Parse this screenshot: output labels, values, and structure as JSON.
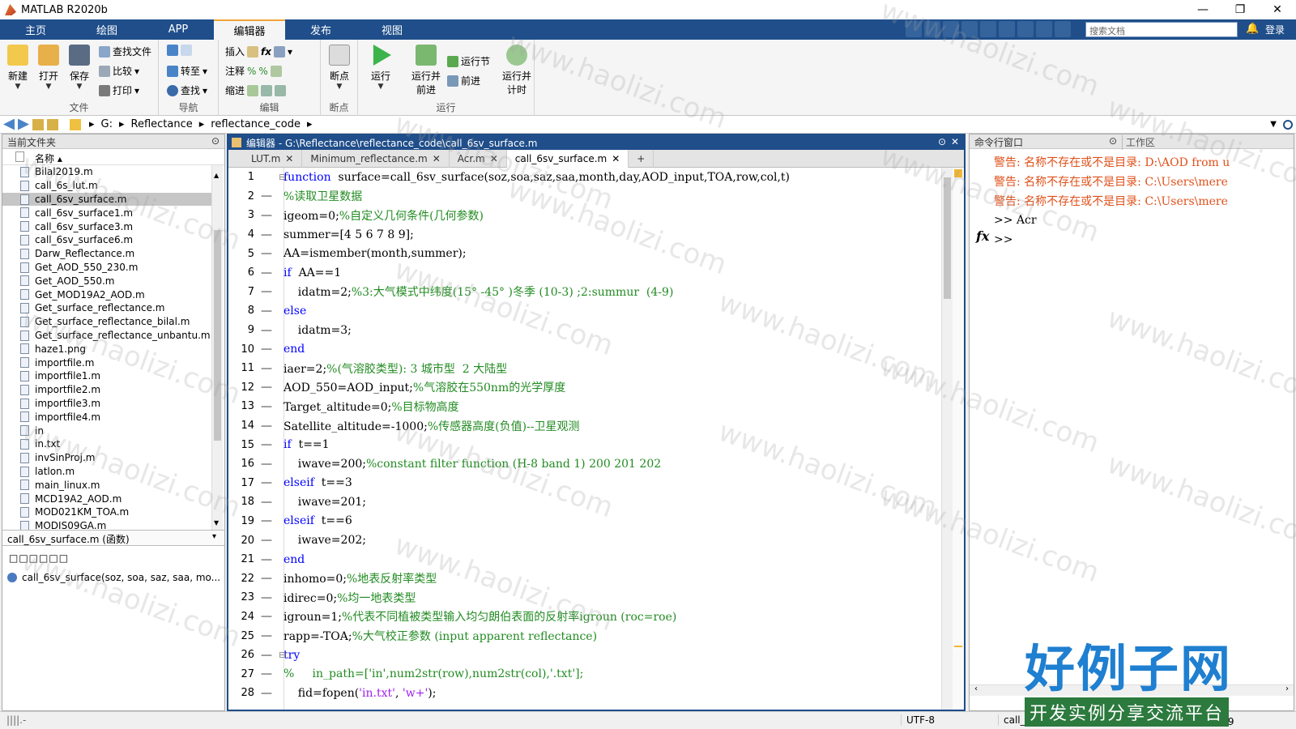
{
  "window": {
    "title": "MATLAB R2020b",
    "min": "—",
    "max": "❐",
    "close": "✕"
  },
  "tabs": [
    "主页",
    "绘图",
    "APP",
    "编辑器",
    "发布",
    "视图"
  ],
  "search": {
    "placeholder": "搜索文档"
  },
  "login": "登录",
  "ribbon": {
    "file": {
      "label": "文件",
      "new": "新建",
      "open": "打开",
      "save": "保存",
      "find_files": "查找文件",
      "compare": "比较",
      "print": "打印"
    },
    "nav": {
      "label": "导航",
      "goto": "转至",
      "find": "查找"
    },
    "edit": {
      "label": "编辑",
      "insert": "插入",
      "comment": "注释",
      "indent": "缩进"
    },
    "breakpoints": {
      "label": "断点",
      "breakpoint": "断点"
    },
    "run": {
      "label": "运行",
      "run": "运行",
      "run_advance": "运行并\n前进",
      "run_section": "运行节",
      "advance": "前进",
      "run_time": "运行并\n计时"
    }
  },
  "address": {
    "drive": "G:",
    "parts": [
      "Reflectance",
      "reflectance_code"
    ]
  },
  "current_folder": {
    "title": "当前文件夹",
    "col_name": "名称 ▴",
    "files": [
      "Bilal2019.m",
      "call_6s_lut.m",
      "call_6sv_surface.m",
      "call_6sv_surface1.m",
      "call_6sv_surface3.m",
      "call_6sv_surface6.m",
      "Darw_Reflectance.m",
      "Get_AOD_550_230.m",
      "Get_AOD_550.m",
      "Get_MOD19A2_AOD.m",
      "Get_surface_reflectance.m",
      "Get_surface_reflectance_bilal.m",
      "Get_surface_reflectance_unbantu.m",
      "haze1.png",
      "importfile.m",
      "importfile1.m",
      "importfile2.m",
      "importfile3.m",
      "importfile4.m",
      "in",
      "in.txt",
      "invSinProj.m",
      "latlon.m",
      "main_linux.m",
      "MCD19A2_AOD.m",
      "MOD021KM_TOA.m",
      "MODIS09GA.m"
    ],
    "selected": "call_6sv_surface.m",
    "detail_title": "call_6sv_surface.m  (函数)",
    "detail_box": "□□□□□□",
    "detail_sig": "call_6sv_surface(soz, soa, saz, saa, mo..."
  },
  "editor": {
    "title": "编辑器 - G:\\Reflectance\\reflectance_code\\call_6sv_surface.m",
    "tabs": [
      "LUT.m",
      "Minimum_reflectance.m",
      "Acr.m",
      "call_6sv_surface.m"
    ],
    "active_tab": "call_6sv_surface.m",
    "plus": "+",
    "lines": [
      [
        [
          "kw",
          "function"
        ],
        [
          "",
          "  surface=call_6sv_surface(soz,soa,saz,saa,month,day,AOD_input,TOA,row,col,t)"
        ]
      ],
      [
        [
          "cm",
          "%读取卫星数据"
        ]
      ],
      [
        [
          "",
          "igeom=0;"
        ],
        [
          "cm",
          "%自定义几何条件(几何参数)"
        ]
      ],
      [
        [
          "",
          "summer=[4 5 6 7 8 9];"
        ]
      ],
      [
        [
          "",
          "AA=ismember(month,summer);"
        ]
      ],
      [
        [
          "kw",
          "if"
        ],
        [
          "",
          "  AA==1"
        ]
      ],
      [
        [
          "",
          "    idatm=2;"
        ],
        [
          "cm",
          "%3:大气模式中纬度(15° -45° )冬季 (10-3) ;2:summur  (4-9)"
        ]
      ],
      [
        [
          "kw",
          "else"
        ]
      ],
      [
        [
          "",
          "    idatm=3;"
        ]
      ],
      [
        [
          "kw",
          "end"
        ]
      ],
      [
        [
          "",
          "iaer=2;"
        ],
        [
          "cm",
          "%(气溶胶类型): 3 城市型  2 大陆型"
        ]
      ],
      [
        [
          "",
          "AOD_550=AOD_input;"
        ],
        [
          "cm",
          "%气溶胶在550nm的光学厚度"
        ]
      ],
      [
        [
          "",
          "Target_altitude=0;"
        ],
        [
          "cm",
          "%目标物高度"
        ]
      ],
      [
        [
          "",
          "Satellite_altitude=-1000;"
        ],
        [
          "cm",
          "%传感器高度(负值)--卫星观测"
        ]
      ],
      [
        [
          "kw",
          "if"
        ],
        [
          "",
          "  t==1"
        ]
      ],
      [
        [
          "",
          "    iwave=200;"
        ],
        [
          "cm",
          "%constant filter function (H-8 band 1) 200 201 202"
        ]
      ],
      [
        [
          "kw",
          "elseif"
        ],
        [
          "",
          "  t==3"
        ]
      ],
      [
        [
          "",
          "    iwave=201;"
        ]
      ],
      [
        [
          "kw",
          "elseif"
        ],
        [
          "",
          "  t==6"
        ]
      ],
      [
        [
          "",
          "    iwave=202;"
        ]
      ],
      [
        [
          "kw",
          "end"
        ]
      ],
      [
        [
          "",
          "inhomo=0;"
        ],
        [
          "cm",
          "%地表反射率类型"
        ]
      ],
      [
        [
          "",
          "idirec=0;"
        ],
        [
          "cm",
          "%均一地表类型"
        ]
      ],
      [
        [
          "",
          "igroun=1;"
        ],
        [
          "cm",
          "%代表不同植被类型输入均匀朗伯表面的反射率igroun (roc=roe)"
        ]
      ],
      [
        [
          "",
          "rapp=-TOA;"
        ],
        [
          "cm",
          "%大气校正参数 (input apparent reflectance)"
        ]
      ],
      [
        [
          "kw",
          "try"
        ]
      ],
      [
        [
          "cm",
          "%     in_path=['in',num2str(row),num2str(col),'.txt'];"
        ]
      ],
      [
        [
          "",
          "    fid=fopen("
        ],
        [
          "st",
          "'in.txt'"
        ],
        [
          "",
          ", "
        ],
        [
          "st",
          "'w+'"
        ],
        [
          "",
          ");"
        ]
      ]
    ]
  },
  "command_window": {
    "title": "命令行窗口",
    "workspace_title": "工作区",
    "lines": [
      {
        "cls": "warn",
        "text": "警告: 名称不存在或不是目录: D:\\AOD from u"
      },
      {
        "cls": "warn",
        "text": "警告: 名称不存在或不是目录: C:\\Users\\mere"
      },
      {
        "cls": "warn",
        "text": "警告: 名称不存在或不是目录: C:\\Users\\mere"
      },
      {
        "cls": "",
        "text": ">> Acr"
      },
      {
        "cls": "",
        "text": ">>"
      }
    ],
    "fx": "fx"
  },
  "status": {
    "encoding": "UTF-8",
    "script": "call_6sv_surface",
    "row": "行 6",
    "col": "列 9"
  },
  "watermark": "www.haolizi.com",
  "brand": {
    "line1": "好例子网",
    "line2": "开发实例分享交流平台"
  }
}
